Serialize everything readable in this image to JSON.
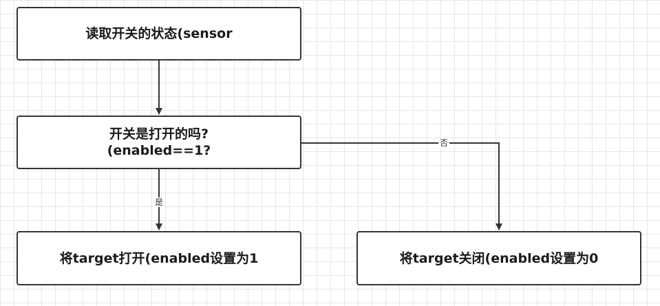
{
  "diagram": {
    "nodes": {
      "read_state": "读取开关的状态(sensor",
      "check_line1": "开关是打开的吗?",
      "check_line2": "(enabled==1?",
      "set_on": "将target打开(enabled设置为1",
      "set_off": "将target关闭(enabled设置为0"
    },
    "edges": {
      "yes_label": "是",
      "no_label": "否"
    }
  }
}
